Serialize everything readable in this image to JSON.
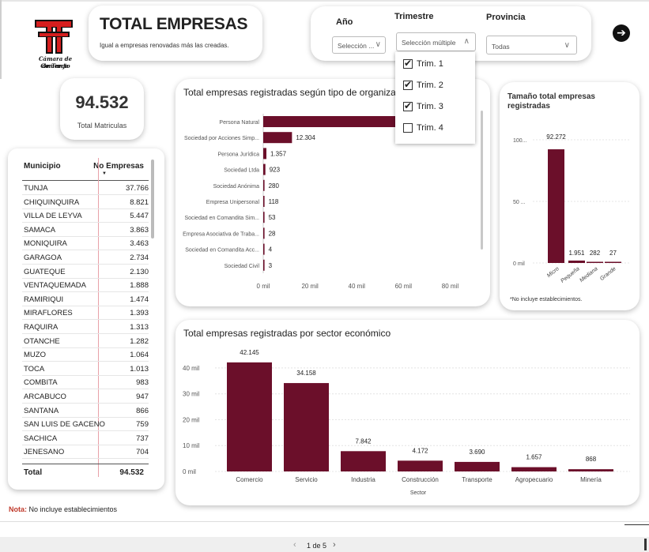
{
  "logo": {
    "line1": "Cámara de Comercio",
    "line2": "de Tunja"
  },
  "header": {
    "title": "TOTAL EMPRESAS",
    "subtitle": "Igual a empresas renovadas más las creadas."
  },
  "filters": {
    "year_label": "Año",
    "year_value": "Selección ...",
    "quarter_label": "Trimestre",
    "quarter_value": "Selección múltiple",
    "province_label": "Provincia",
    "province_value": "Todas",
    "quarter_options": [
      {
        "label": "Trim. 1",
        "checked": true
      },
      {
        "label": "Trim. 2",
        "checked": true
      },
      {
        "label": "Trim. 3",
        "checked": true
      },
      {
        "label": "Trim. 4",
        "checked": false
      }
    ]
  },
  "kpi": {
    "value": "94.532",
    "label": "Total Matriculas"
  },
  "municipio_table": {
    "col_municipio": "Municipio",
    "col_empresas": "No Empresas",
    "rows": [
      [
        "TUNJA",
        "37.766"
      ],
      [
        "CHIQUINQUIRA",
        "8.821"
      ],
      [
        "VILLA DE LEYVA",
        "5.447"
      ],
      [
        "SAMACA",
        "3.863"
      ],
      [
        "MONIQUIRA",
        "3.463"
      ],
      [
        "GARAGOA",
        "2.734"
      ],
      [
        "GUATEQUE",
        "2.130"
      ],
      [
        "VENTAQUEMADA",
        "1.888"
      ],
      [
        "RAMIRIQUI",
        "1.474"
      ],
      [
        "MIRAFLORES",
        "1.393"
      ],
      [
        "RAQUIRA",
        "1.313"
      ],
      [
        "OTANCHE",
        "1.282"
      ],
      [
        "MUZO",
        "1.064"
      ],
      [
        "TOCA",
        "1.013"
      ],
      [
        "COMBITA",
        "983"
      ],
      [
        "ARCABUCO",
        "947"
      ],
      [
        "SANTANA",
        "866"
      ],
      [
        "SAN LUIS DE GACENO",
        "759"
      ],
      [
        "SACHICA",
        "737"
      ],
      [
        "JENESANO",
        "704"
      ]
    ],
    "total_label": "Total",
    "total_value": "94.532"
  },
  "note": {
    "prefix": "Nota:",
    "text": " No incluye establecimientos"
  },
  "footer": {
    "pager": "1 de 5",
    "prev": "‹",
    "next": "›"
  },
  "colors": {
    "bar": "#6b0f2a",
    "accent": "#c0392b"
  },
  "chart_data": [
    {
      "type": "bar",
      "orientation": "horizontal",
      "title": "Total empresas registradas según tipo de organización",
      "categories": [
        "Persona Natural",
        "Sociedad por Acciones Simp...",
        "Persona Jurídica",
        "Sociedad Ltda",
        "Sociedad Anónima",
        "Empresa Unipersonal",
        "Sociedad en Comandita Sim...",
        "Empresa Asociativa de Traba...",
        "Sociedad en Comandita Acc...",
        "Sociedad Civil"
      ],
      "values": [
        null,
        12304,
        1357,
        923,
        280,
        118,
        53,
        28,
        4,
        3
      ],
      "value_labels": [
        "",
        "12.304",
        "1.357",
        "923",
        "280",
        "118",
        "53",
        "28",
        "4",
        "3"
      ],
      "xticks": [
        "0 mil",
        "20 mil",
        "40 mil",
        "60 mil",
        "80 mil"
      ],
      "xlim": [
        0,
        90000
      ]
    },
    {
      "type": "bar",
      "title": "Tamaño total empresas registradas",
      "categories": [
        "Micro",
        "Pequeña",
        "Mediana",
        "Grande"
      ],
      "values": [
        92272,
        1951,
        282,
        27
      ],
      "value_labels": [
        "92.272",
        "1.951",
        "282",
        "27"
      ],
      "yticks": [
        "0 mil",
        "50 ...",
        "100..."
      ],
      "ylim": [
        0,
        100000
      ],
      "footnote": "*No incluye establecimientos."
    },
    {
      "type": "bar",
      "title": "Total empresas registradas por sector económico",
      "xlabel": "Sector",
      "categories": [
        "Comercio",
        "Servicio",
        "Industria",
        "Construcción",
        "Transporte",
        "Agropecuario",
        "Minería"
      ],
      "values": [
        42145,
        34158,
        7842,
        4172,
        3690,
        1657,
        868
      ],
      "value_labels": [
        "42.145",
        "34.158",
        "7.842",
        "4.172",
        "3.690",
        "1.657",
        "868"
      ],
      "yticks": [
        "0 mil",
        "10 mil",
        "20 mil",
        "30 mil",
        "40 mil"
      ],
      "ylim": [
        0,
        47000
      ]
    }
  ]
}
